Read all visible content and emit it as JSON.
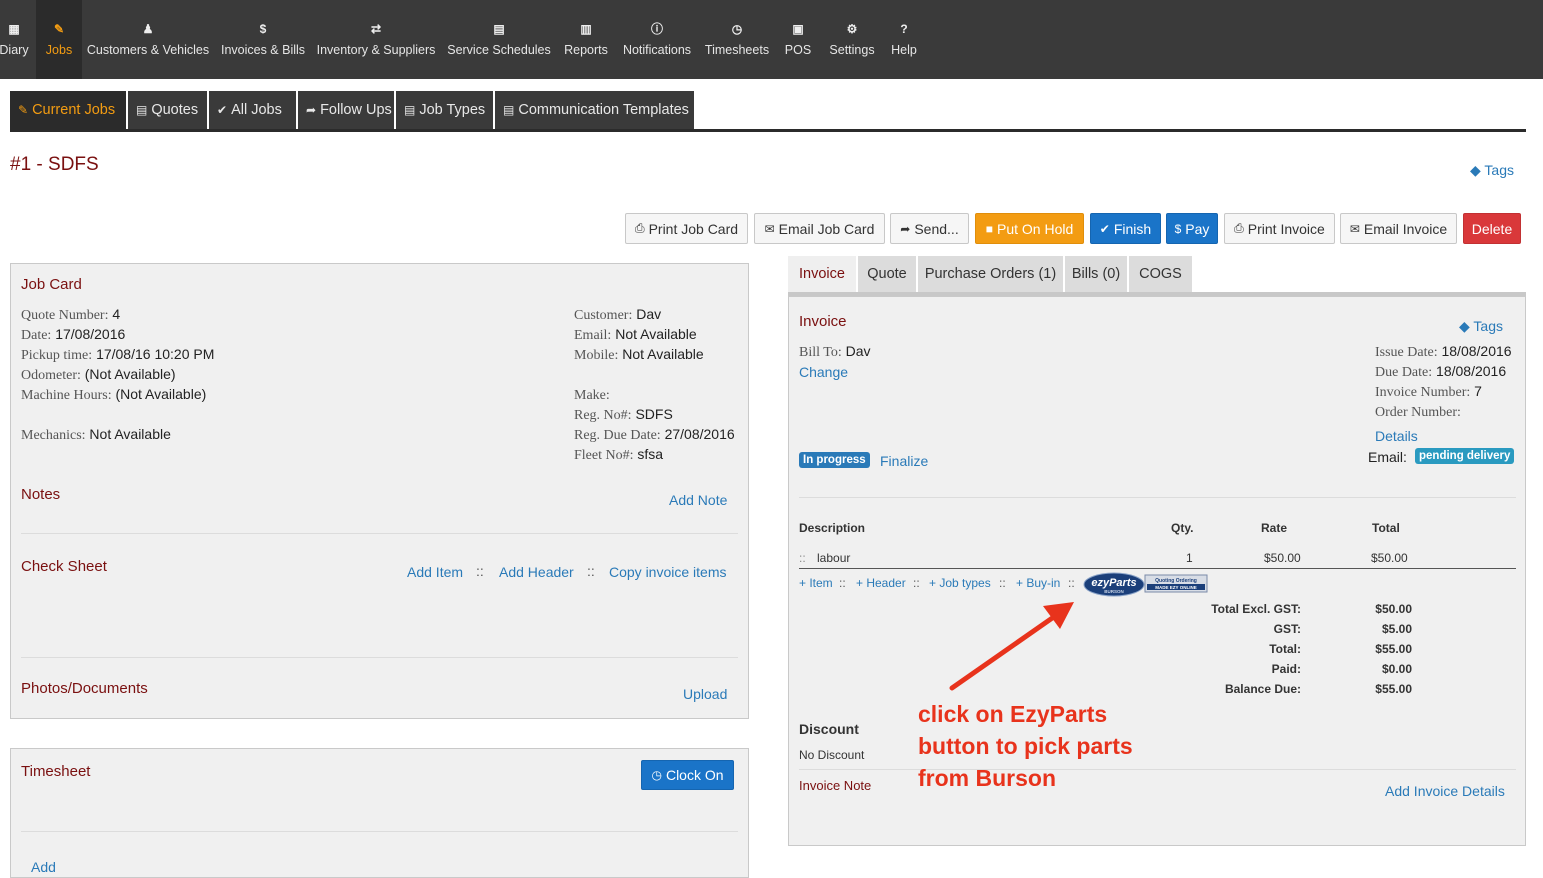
{
  "topnav": [
    {
      "label": "Diary",
      "icon": "calendar-icon",
      "glyph": "▦"
    },
    {
      "label": "Jobs",
      "icon": "wrench-icon",
      "glyph": "✎"
    },
    {
      "label": "Customers & Vehicles",
      "icon": "users-icon",
      "glyph": "♟"
    },
    {
      "label": "Invoices & Bills",
      "icon": "dollar-icon",
      "glyph": "$"
    },
    {
      "label": "Inventory & Suppliers",
      "icon": "exchange-icon",
      "glyph": "⇄"
    },
    {
      "label": "Service Schedules",
      "icon": "calendar-icon",
      "glyph": "▤"
    },
    {
      "label": "Reports",
      "icon": "bar-chart-icon",
      "glyph": "▥"
    },
    {
      "label": "Notifications",
      "icon": "info-icon",
      "glyph": "ⓘ"
    },
    {
      "label": "Timesheets",
      "icon": "clock-icon",
      "glyph": "◷"
    },
    {
      "label": "POS",
      "icon": "money-icon",
      "glyph": "▣"
    },
    {
      "label": "Settings",
      "icon": "gears-icon",
      "glyph": "⚙"
    },
    {
      "label": "Help",
      "icon": "question-icon",
      "glyph": "?"
    }
  ],
  "subtabs": [
    {
      "label": "Current Jobs",
      "glyph": "✎"
    },
    {
      "label": "Quotes",
      "glyph": "▤"
    },
    {
      "label": "All Jobs",
      "glyph": "✔"
    },
    {
      "label": "Follow Ups",
      "glyph": "➦"
    },
    {
      "label": "Job Types",
      "glyph": "▤"
    },
    {
      "label": "Communication Templates",
      "glyph": "▤"
    }
  ],
  "page": {
    "title": "#1 - SDFS",
    "tags": "Tags"
  },
  "actions": {
    "print_job_card": "Print Job Card",
    "email_job_card": "Email Job Card",
    "send": "Send...",
    "put_on_hold": "Put On Hold",
    "finish": "Finish",
    "pay": "Pay",
    "print_invoice": "Print Invoice",
    "email_invoice": "Email Invoice",
    "delete": "Delete"
  },
  "job_card": {
    "title": "Job Card",
    "quote_number_label": "Quote Number:",
    "quote_number": "4",
    "date_label": "Date:",
    "date": "17/08/2016",
    "pickup_label": "Pickup time:",
    "pickup": "17/08/16 10:20 PM",
    "odometer_label": "Odometer:",
    "odometer": "(Not Available)",
    "machine_hours_label": "Machine Hours:",
    "machine_hours": "(Not Available)",
    "mechanics_label": "Mechanics:",
    "mechanics": "Not Available",
    "customer_label": "Customer:",
    "customer": "Dav",
    "email_label": "Email:",
    "email": "Not Available",
    "mobile_label": "Mobile:",
    "mobile": "Not Available",
    "make_label": "Make:",
    "reg_no_label": "Reg. No#:",
    "reg_no": "SDFS",
    "reg_due_label": "Reg. Due Date:",
    "reg_due": "27/08/2016",
    "fleet_label": "Fleet No#:",
    "fleet": "sfsa",
    "notes_title": "Notes",
    "add_note": "Add Note",
    "check_sheet_title": "Check Sheet",
    "add_item": "Add Item",
    "add_header": "Add Header",
    "copy_invoice_items": "Copy invoice items",
    "sep": "::",
    "photos_title": "Photos/Documents",
    "upload": "Upload"
  },
  "timesheet": {
    "title": "Timesheet",
    "clock_on": "Clock On",
    "add": "Add"
  },
  "invoice_tabs": [
    "Invoice",
    "Quote",
    "Purchase Orders (1)",
    "Bills (0)",
    "COGS"
  ],
  "invoice": {
    "title": "Invoice",
    "tags": "Tags",
    "bill_to_label": "Bill To:",
    "bill_to": "Dav",
    "change": "Change",
    "issue_date_label": "Issue Date:",
    "issue_date": "18/08/2016",
    "due_date_label": "Due Date:",
    "due_date": "18/08/2016",
    "invoice_number_label": "Invoice Number:",
    "invoice_number": "7",
    "order_number_label": "Order Number:",
    "details": "Details",
    "status_badge": "In progress",
    "finalize": "Finalize",
    "email_label": "Email:",
    "email_badge": "pending delivery",
    "columns": {
      "description": "Description",
      "qty": "Qty.",
      "rate": "Rate",
      "total": "Total"
    },
    "line_items": [
      {
        "handle": "::",
        "description": "labour",
        "qty": "1",
        "rate": "$50.00",
        "total": "$50.00"
      }
    ],
    "add_links": {
      "item": "+ Item",
      "header": "+ Header",
      "job_types": "+ Job types",
      "buy_in": "+ Buy-in",
      "sep": "::"
    },
    "ezyparts": {
      "logo": "ezyParts",
      "tagline": "Quoting Ordering",
      "tagline2": "MADE EZY ONLINE",
      "brand": "BURSON"
    },
    "totals": [
      {
        "label": "Total Excl. GST:",
        "value": "$50.00"
      },
      {
        "label": "GST:",
        "value": "$5.00"
      },
      {
        "label": "Total:",
        "value": "$55.00"
      },
      {
        "label": "Paid:",
        "value": "$0.00"
      },
      {
        "label": "Balance Due:",
        "value": "$55.00"
      }
    ],
    "discount_title": "Discount",
    "discount_value": "No Discount",
    "invoice_note": "Invoice Note",
    "add_invoice_details": "Add Invoice Details"
  },
  "annotation": [
    "click on EzyParts",
    "button to pick parts",
    "from Burson"
  ],
  "colors": {
    "nav_bg": "#3a3a3a",
    "accent_orange": "#f39c12",
    "link_blue": "#2a7ab8",
    "title_maroon": "#7a1010",
    "annotation_red": "#e8331c"
  }
}
